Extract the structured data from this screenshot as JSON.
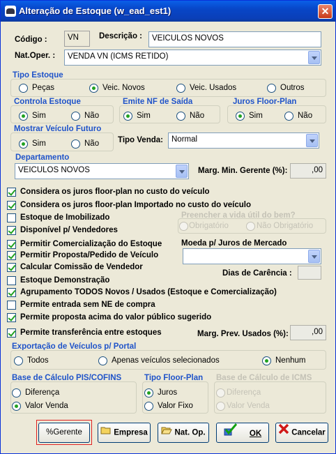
{
  "title": "Alteração de Estoque (w_ead_est1)",
  "close_glyph": "✕",
  "codigo": {
    "label": "Código :",
    "value": "VN"
  },
  "descricao": {
    "label": "Descrição :",
    "value": "VEICULOS NOVOS"
  },
  "natoper": {
    "label": "Nat.Oper. :",
    "value": "VENDA VN (ICMS RETIDO)"
  },
  "tipo_estoque": {
    "title": "Tipo Estoque",
    "options": [
      "Peças",
      "Veic. Novos",
      "Veic. Usados",
      "Outros"
    ],
    "selected": "Veic. Novos"
  },
  "controla_estoque": {
    "title": "Controla Estoque",
    "options": [
      "Sim",
      "Não"
    ]
  },
  "emite_nf": {
    "title": "Emite NF de Saída",
    "options": [
      "Sim",
      "Não"
    ]
  },
  "juros_floor": {
    "title": "Juros Floor-Plan",
    "options": [
      "Sim",
      "Não"
    ]
  },
  "mostrar_veiculo": {
    "title": "Mostrar Veículo Futuro",
    "options": [
      "Sim",
      "Não"
    ]
  },
  "tipo_venda": {
    "label": "Tipo Venda:",
    "value": "Normal"
  },
  "departamento": {
    "title": "Departamento",
    "value": "VEICULOS NOVOS"
  },
  "marg_min": {
    "label": "Marg. Min. Gerente (%):",
    "value": ",00"
  },
  "checks": [
    {
      "label": "Considera os juros floor-plan no custo do veículo",
      "checked": true
    },
    {
      "label": "Considera os juros floor-plan Importado no custo do veículo",
      "checked": true
    },
    {
      "label": "Estoque de Imobilizado",
      "checked": false
    },
    {
      "label": "Disponível p/ Vendedores",
      "checked": true
    },
    {
      "label": "Permitir Comercialização do Estoque",
      "checked": true
    },
    {
      "label": "Permitir Proposta/Pedido de Veículo",
      "checked": true
    },
    {
      "label": "Calcular Comissão de Vendedor",
      "checked": true
    },
    {
      "label": "Estoque Demonstração",
      "checked": false
    },
    {
      "label": "Agrupamento TODOS Novos / Usados (Estoque e Comercialização)",
      "checked": true
    },
    {
      "label": "Permite entrada sem NE de compra",
      "checked": false
    },
    {
      "label": "Permite proposta acima do valor público sugerido",
      "checked": true
    },
    {
      "label": "Permite transferência entre estoques",
      "checked": true
    }
  ],
  "vida_util": {
    "title": "Preencher a vida útil do bem?",
    "options": [
      "Obrigatório",
      "Não Obrigatório"
    ]
  },
  "moeda": {
    "label": "Moeda p/ Juros de Mercado",
    "value": ""
  },
  "carencia": {
    "label": "Dias de Carência :",
    "value": ""
  },
  "marg_prev": {
    "label": "Marg. Prev. Usados (%):",
    "value": ",00"
  },
  "exportacao": {
    "title": "Exportação de Veículos p/ Portal",
    "options": [
      "Todos",
      "Apenas veículos selecionados",
      "Nenhum"
    ]
  },
  "base_pis": {
    "title": "Base de Cálculo PIS/COFINS",
    "options": [
      "Diferença",
      "Valor Venda"
    ]
  },
  "tipo_floor": {
    "title": "Tipo Floor-Plan",
    "options": [
      "Juros",
      "Valor Fixo"
    ]
  },
  "base_icms": {
    "title": "Base de Cálculo de ICMS",
    "options": [
      "Diferença",
      "Valor Venda"
    ]
  },
  "buttons": {
    "gerente": "%Gerente",
    "empresa": "Empresa",
    "natop": "Nat. Op.",
    "ok": "OK",
    "cancelar": "Cancelar"
  },
  "colors": {
    "accent": "#1f53c9",
    "title_bar": "#0a46c7",
    "focus": "#e02020"
  }
}
